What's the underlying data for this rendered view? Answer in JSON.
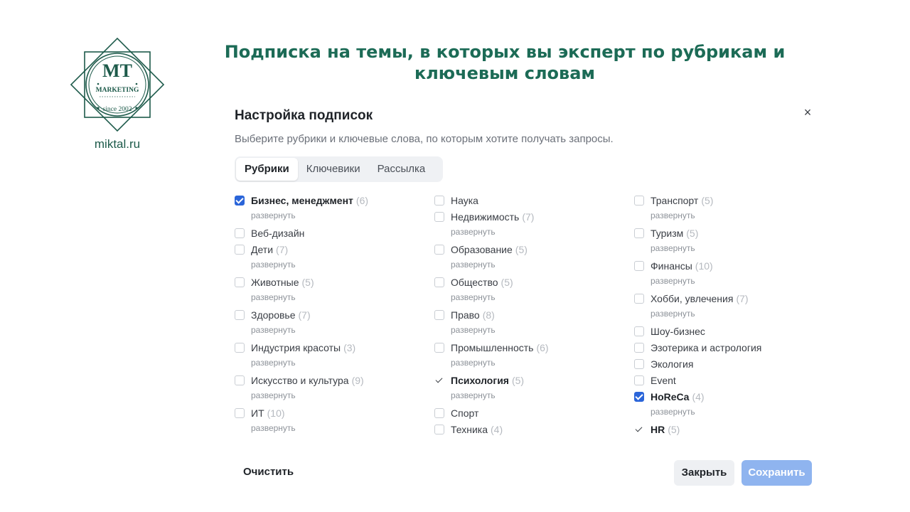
{
  "logo": {
    "initials": "MT",
    "word": "MARKETING",
    "since": "since 2002",
    "site": "miktal.ru",
    "color": "#1d5a4a"
  },
  "headline": {
    "line1": "Подписка на темы, в которых вы эксперт по рубрикам и",
    "line2": "ключевым словам"
  },
  "modal": {
    "title": "Настройка подписок",
    "subtitle": "Выберите рубрики и ключевые слова, по которым хотите получать запросы.",
    "close_icon": "×",
    "tabs": [
      {
        "label": "Рубрики",
        "active": true
      },
      {
        "label": "Ключевики",
        "active": false
      },
      {
        "label": "Рассылка",
        "active": false
      }
    ],
    "expand_label": "развернуть",
    "columns": [
      [
        {
          "label": "Бизнес, менеджмент",
          "count": "(6)",
          "state": "checked",
          "expand": true
        },
        {
          "label": "Веб-дизайн",
          "count": "",
          "state": "unchecked",
          "expand": false
        },
        {
          "label": "Дети",
          "count": "(7)",
          "state": "unchecked",
          "expand": true
        },
        {
          "label": "Животные",
          "count": "(5)",
          "state": "unchecked",
          "expand": true
        },
        {
          "label": "Здоровье",
          "count": "(7)",
          "state": "unchecked",
          "expand": true
        },
        {
          "label": "Индустрия красоты",
          "count": "(3)",
          "state": "unchecked",
          "expand": true
        },
        {
          "label": "Искусство и культура",
          "count": "(9)",
          "state": "unchecked",
          "expand": true
        },
        {
          "label": "ИТ",
          "count": "(10)",
          "state": "unchecked",
          "expand": true
        }
      ],
      [
        {
          "label": "Наука",
          "count": "",
          "state": "unchecked",
          "expand": false
        },
        {
          "label": "Недвижимость",
          "count": "(7)",
          "state": "unchecked",
          "expand": true
        },
        {
          "label": "Образование",
          "count": "(5)",
          "state": "unchecked",
          "expand": true
        },
        {
          "label": "Общество",
          "count": "(5)",
          "state": "unchecked",
          "expand": true
        },
        {
          "label": "Право",
          "count": "(8)",
          "state": "unchecked",
          "expand": true
        },
        {
          "label": "Промышленность",
          "count": "(6)",
          "state": "unchecked",
          "expand": true
        },
        {
          "label": "Психология",
          "count": "(5)",
          "state": "light",
          "expand": true
        },
        {
          "label": "Спорт",
          "count": "",
          "state": "unchecked",
          "expand": false
        },
        {
          "label": "Техника",
          "count": "(4)",
          "state": "unchecked",
          "expand": false
        }
      ],
      [
        {
          "label": "Транспорт",
          "count": "(5)",
          "state": "unchecked",
          "expand": true
        },
        {
          "label": "Туризм",
          "count": "(5)",
          "state": "unchecked",
          "expand": true
        },
        {
          "label": "Финансы",
          "count": "(10)",
          "state": "unchecked",
          "expand": true
        },
        {
          "label": "Хобби, увлечения",
          "count": "(7)",
          "state": "unchecked",
          "expand": true
        },
        {
          "label": "Шоу-бизнес",
          "count": "",
          "state": "unchecked",
          "expand": false
        },
        {
          "label": "Эзотерика и астрология",
          "count": "",
          "state": "unchecked",
          "expand": false
        },
        {
          "label": "Экология",
          "count": "",
          "state": "unchecked",
          "expand": false
        },
        {
          "label": "Event",
          "count": "",
          "state": "unchecked",
          "expand": false
        },
        {
          "label": "HoReCa",
          "count": "(4)",
          "state": "checked",
          "expand": true
        },
        {
          "label": "HR",
          "count": "(5)",
          "state": "light",
          "expand": false
        }
      ]
    ],
    "buttons": {
      "clear": "Очистить",
      "close": "Закрыть",
      "save": "Сохранить"
    },
    "colors": {
      "accent": "#2b65d9",
      "save_disabled": "#8fb4ef",
      "headline": "#1c6b56"
    }
  }
}
